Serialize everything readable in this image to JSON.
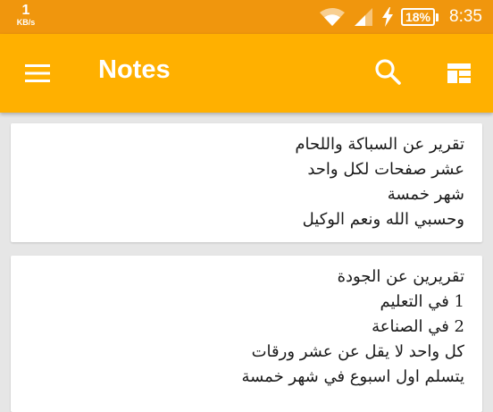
{
  "status_bar": {
    "speed_value": "1",
    "speed_unit": "KB/s",
    "battery": "18%",
    "time": "8:35"
  },
  "app_bar": {
    "title": "Notes",
    "icons": [
      "menu-icon",
      "search-icon",
      "layout-icon"
    ]
  },
  "notes": [
    {
      "lines": [
        "تقرير عن السباكة واللحام",
        "عشر صفحات لكل واحد",
        "شهر خمسة",
        "وحسبي الله ونعم الوكيل"
      ]
    },
    {
      "lines": [
        "تقريرين عن الجودة",
        "1 في التعليم",
        "2 في الصناعة",
        "كل واحد لا يقل عن عشر ورقات",
        "يتسلم اول اسبوع في شهر خمسة"
      ]
    }
  ],
  "colors": {
    "status_bar": "#f0960d",
    "app_bar": "#ffb000",
    "background": "#e6e6e6",
    "card": "#ffffff"
  }
}
